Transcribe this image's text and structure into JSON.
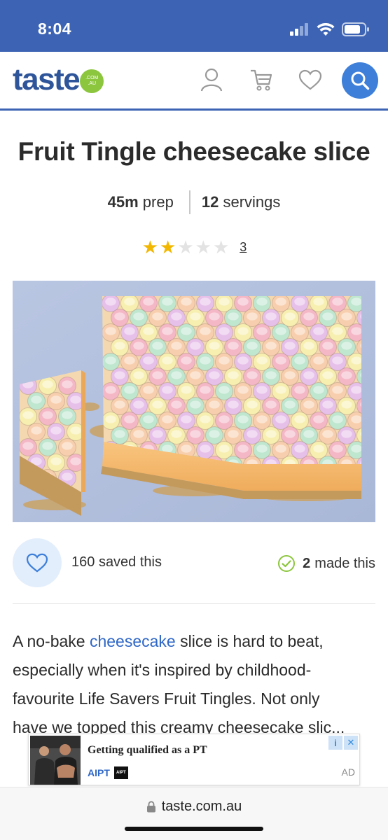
{
  "status_bar": {
    "time": "8:04"
  },
  "header": {
    "logo_text": "taste",
    "logo_badge_line1": ".COM",
    "logo_badge_line2": ".AU"
  },
  "recipe": {
    "title": "Fruit Tingle cheesecake slice",
    "prep_value": "45m",
    "prep_label": "prep",
    "servings_value": "12",
    "servings_label": "servings",
    "rating": 2,
    "rating_max": 5,
    "rating_count": "3"
  },
  "engagement": {
    "saved_count": "160",
    "saved_label": "saved this",
    "made_count": "2",
    "made_label": "made this"
  },
  "description": {
    "line1_pre": "A no-bake ",
    "line1_link": "cheesecake",
    "line1_post": " slice is hard to beat,",
    "line2": "especially when it's inspired by childhood-",
    "line3": "favourite Life Savers Fruit Tingles. Not only",
    "line4": "have we topped this creamy cheesecake slic..."
  },
  "ad": {
    "title": "Getting qualified as a PT",
    "brand": "AIPT",
    "brand_logo": "AIPT",
    "label": "AD",
    "info": "i",
    "close": "✕"
  },
  "browser": {
    "url": "taste.com.au"
  },
  "colors": {
    "brand_blue": "#3d64b4",
    "search_blue": "#3d7fd9",
    "link_blue": "#2f67c7",
    "star_gold": "#f2b700",
    "badge_green": "#8cc63e"
  }
}
